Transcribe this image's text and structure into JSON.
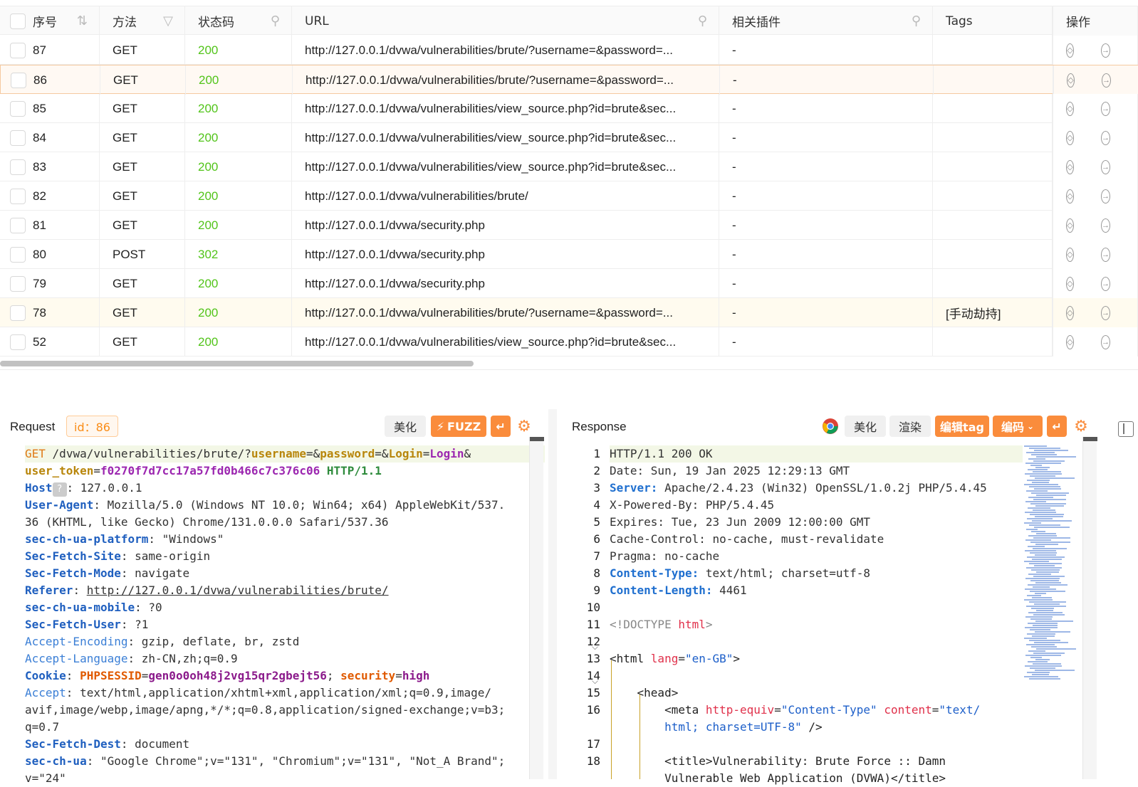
{
  "table": {
    "headers": {
      "seq": "序号",
      "method": "方法",
      "status": "状态码",
      "url": "URL",
      "plugin": "相关插件",
      "tags": "Tags",
      "ops": "操作"
    },
    "rows": [
      {
        "id": "87",
        "method": "GET",
        "status": "200",
        "url": "http://127.0.0.1/dvwa/vulnerabilities/brute/?username=&password=...",
        "plugin": "-",
        "tags": ""
      },
      {
        "id": "86",
        "method": "GET",
        "status": "200",
        "url": "http://127.0.0.1/dvwa/vulnerabilities/brute/?username=&password=...",
        "plugin": "-",
        "tags": ""
      },
      {
        "id": "85",
        "method": "GET",
        "status": "200",
        "url": "http://127.0.0.1/dvwa/vulnerabilities/view_source.php?id=brute&sec...",
        "plugin": "-",
        "tags": ""
      },
      {
        "id": "84",
        "method": "GET",
        "status": "200",
        "url": "http://127.0.0.1/dvwa/vulnerabilities/view_source.php?id=brute&sec...",
        "plugin": "-",
        "tags": ""
      },
      {
        "id": "83",
        "method": "GET",
        "status": "200",
        "url": "http://127.0.0.1/dvwa/vulnerabilities/view_source.php?id=brute&sec...",
        "plugin": "-",
        "tags": ""
      },
      {
        "id": "82",
        "method": "GET",
        "status": "200",
        "url": "http://127.0.0.1/dvwa/vulnerabilities/brute/",
        "plugin": "-",
        "tags": ""
      },
      {
        "id": "81",
        "method": "GET",
        "status": "200",
        "url": "http://127.0.0.1/dvwa/security.php",
        "plugin": "-",
        "tags": ""
      },
      {
        "id": "80",
        "method": "POST",
        "status": "302",
        "url": "http://127.0.0.1/dvwa/security.php",
        "plugin": "-",
        "tags": ""
      },
      {
        "id": "79",
        "method": "GET",
        "status": "200",
        "url": "http://127.0.0.1/dvwa/security.php",
        "plugin": "-",
        "tags": ""
      },
      {
        "id": "78",
        "method": "GET",
        "status": "200",
        "url": "http://127.0.0.1/dvwa/vulnerabilities/brute/?username=&password=...",
        "plugin": "-",
        "tags": "[手动劫持]"
      },
      {
        "id": "52",
        "method": "GET",
        "status": "200",
        "url": "http://127.0.0.1/dvwa/vulnerabilities/view_source.php?id=brute&sec...",
        "plugin": "-",
        "tags": ""
      }
    ]
  },
  "request": {
    "title": "Request",
    "id_label": "id：86",
    "beautify": "美化",
    "fuzz": "FUZZ",
    "lines": {
      "l1_method": "GET",
      "l1_path": "/dvwa/vulnerabilities/brute/?",
      "l1_p1": "username",
      "l1_p2": "password",
      "l1_p3": "Login",
      "l1_v3": "Login",
      "l2_p": "user_token",
      "l2_v": "f0270f7d7cc17a57fd0b466c7c376c06",
      "l2_proto": "HTTP/1.1",
      "host_k": "Host",
      "host_badge": "?",
      "host_v": "127.0.0.1",
      "ua_k": "User-Agent",
      "ua_v1": "Mozilla/5.0 (Windows NT 10.0; Win64; x64) AppleWebKit/537.",
      "ua_v2": "36 (KHTML, like Gecko) Chrome/131.0.0.0 Safari/537.36",
      "plat_k": "sec-ch-ua-platform",
      "plat_v": "\"Windows\"",
      "site_k": "Sec-Fetch-Site",
      "site_v": "same-origin",
      "mode_k": "Sec-Fetch-Mode",
      "mode_v": "navigate",
      "ref_k": "Referer",
      "ref_v": "http://127.0.0.1/dvwa/vulnerabilities/brute/",
      "mob_k": "sec-ch-ua-mobile",
      "mob_v": "?0",
      "user_k": "Sec-Fetch-User",
      "user_v": "?1",
      "enc_k": "Accept-Encoding",
      "enc_v": "gzip, deflate, br, zstd",
      "lang_k": "Accept-Language",
      "lang_v": "zh-CN,zh;q=0.9",
      "cookie_k": "Cookie",
      "ck1": "PHPSESSID",
      "cv1": "gen0o0oh48j2vg15qr2gbejt56",
      "ck2": "security",
      "cv2": "high",
      "acc_k": "Accept",
      "acc_v1": "text/html,application/xhtml+xml,application/xml;q=0.9,image/",
      "acc_v2": "avif,image/webp,image/apng,*/*;q=0.8,application/signed-exchange;v=b3;",
      "acc_v3": "q=0.7",
      "dest_k": "Sec-Fetch-Dest",
      "dest_v": "document",
      "ua2_k": "sec-ch-ua",
      "ua2_v": "\"Google Chrome\";v=\"131\", \"Chromium\";v=\"131\", \"Not_A Brand\";",
      "ua2_v2": "v=\"24\""
    }
  },
  "response": {
    "title": "Response",
    "beautify": "美化",
    "render": "渲染",
    "edit_tag": "编辑tag",
    "encode": "编码",
    "line_numbers": [
      "1",
      "2",
      "3",
      "4",
      "5",
      "6",
      "7",
      "8",
      "9",
      "10",
      "11",
      "12",
      "13",
      "14",
      "15",
      "16",
      "",
      "17",
      "18"
    ],
    "lines": {
      "r1": "HTTP/1.1 200 OK",
      "r2": "Date: Sun, 19 Jan 2025 12:29:13 GMT",
      "r3_k": "Server:",
      "r3_v": " Apache/2.4.23 (Win32) OpenSSL/1.0.2j PHP/5.4.45",
      "r4": "X-Powered-By: PHP/5.4.45",
      "r5": "Expires: Tue, 23 Jun 2009 12:00:00 GMT",
      "r6": "Cache-Control: no-cache, must-revalidate",
      "r7": "Pragma: no-cache",
      "r8_k": "Content-Type:",
      "r8_v": " text/html; charset=utf-8",
      "r9_k": "Content-Length:",
      "r9_v": " 4461",
      "r11_a": "<!DOCTYPE ",
      "r11_b": "html",
      "r11_c": ">",
      "r13_tag": "<html ",
      "r13_attr": "lang",
      "r13_val": "\"en-GB\"",
      "r13_end": ">",
      "r15": "<head>",
      "r16_tag": "<meta ",
      "r16_a1": "http-equiv",
      "r16_v1": "\"Content-Type\"",
      "r16_a2": "content",
      "r16_v2a": "\"text/",
      "r16_v2b": "html; charset=UTF-8\"",
      "r16_end": " />",
      "r18_a": "<title>Vulnerability: Brute Force :: Damn",
      "r18_b": "Vulnerable Web Application (DVWA)</title>"
    }
  },
  "colors": {
    "accent": "#fa8c3c",
    "status_ok": "#52c41a",
    "header_key": "#1f5fbf"
  }
}
